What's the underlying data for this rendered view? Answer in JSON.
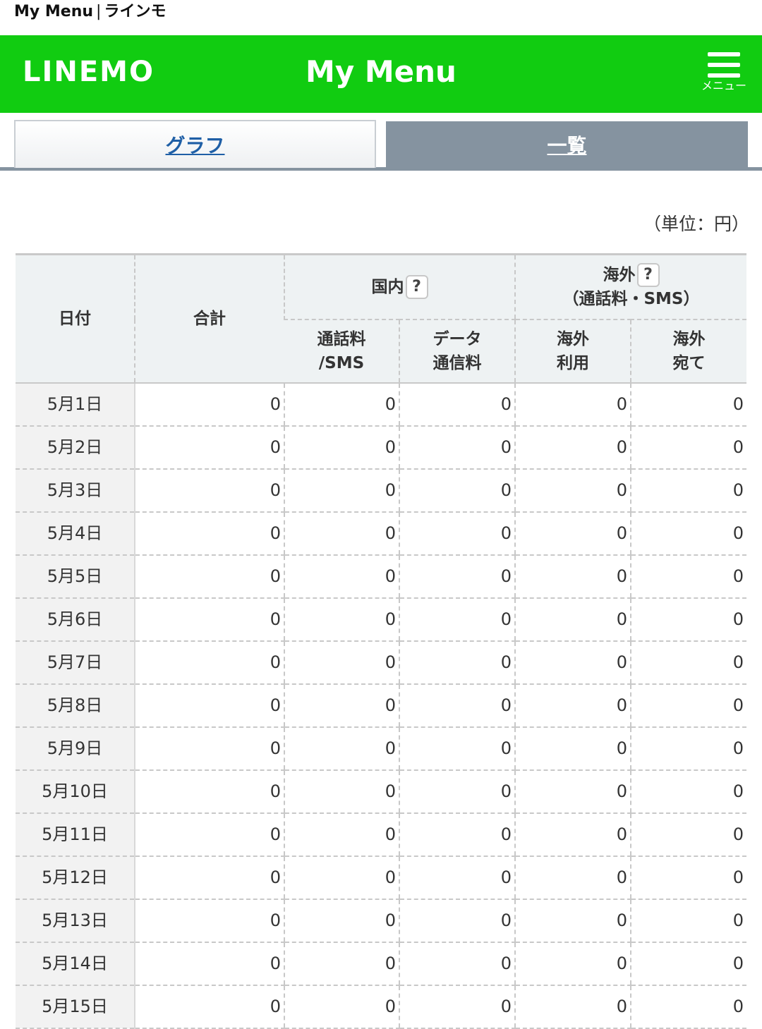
{
  "page_title": {
    "app": "My Menu",
    "sep": "|",
    "brand": "ラインモ"
  },
  "header": {
    "logo": "LINEMO",
    "title": "My Menu",
    "menu_label": "メニュー"
  },
  "tabs": [
    {
      "label": "グラフ"
    },
    {
      "label": "一覧"
    }
  ],
  "unit_label": "（単位：円）",
  "table": {
    "headers": {
      "date": "日付",
      "total": "合計",
      "domestic": "国内",
      "overseas": "海外",
      "overseas_sub": "（通話料・SMS）",
      "call_sms_1": "通話料",
      "call_sms_2": "/SMS",
      "data_1": "データ",
      "data_2": "通信料",
      "ov_use_1": "海外",
      "ov_use_2": "利用",
      "ov_to_1": "海外",
      "ov_to_2": "宛て",
      "help": "?"
    },
    "rows": [
      {
        "date": "5月1日",
        "total": "0",
        "call": "0",
        "data": "0",
        "ov_use": "0",
        "ov_to": "0"
      },
      {
        "date": "5月2日",
        "total": "0",
        "call": "0",
        "data": "0",
        "ov_use": "0",
        "ov_to": "0"
      },
      {
        "date": "5月3日",
        "total": "0",
        "call": "0",
        "data": "0",
        "ov_use": "0",
        "ov_to": "0"
      },
      {
        "date": "5月4日",
        "total": "0",
        "call": "0",
        "data": "0",
        "ov_use": "0",
        "ov_to": "0"
      },
      {
        "date": "5月5日",
        "total": "0",
        "call": "0",
        "data": "0",
        "ov_use": "0",
        "ov_to": "0"
      },
      {
        "date": "5月6日",
        "total": "0",
        "call": "0",
        "data": "0",
        "ov_use": "0",
        "ov_to": "0"
      },
      {
        "date": "5月7日",
        "total": "0",
        "call": "0",
        "data": "0",
        "ov_use": "0",
        "ov_to": "0"
      },
      {
        "date": "5月8日",
        "total": "0",
        "call": "0",
        "data": "0",
        "ov_use": "0",
        "ov_to": "0"
      },
      {
        "date": "5月9日",
        "total": "0",
        "call": "0",
        "data": "0",
        "ov_use": "0",
        "ov_to": "0"
      },
      {
        "date": "5月10日",
        "total": "0",
        "call": "0",
        "data": "0",
        "ov_use": "0",
        "ov_to": "0"
      },
      {
        "date": "5月11日",
        "total": "0",
        "call": "0",
        "data": "0",
        "ov_use": "0",
        "ov_to": "0"
      },
      {
        "date": "5月12日",
        "total": "0",
        "call": "0",
        "data": "0",
        "ov_use": "0",
        "ov_to": "0"
      },
      {
        "date": "5月13日",
        "total": "0",
        "call": "0",
        "data": "0",
        "ov_use": "0",
        "ov_to": "0"
      },
      {
        "date": "5月14日",
        "total": "0",
        "call": "0",
        "data": "0",
        "ov_use": "0",
        "ov_to": "0"
      },
      {
        "date": "5月15日",
        "total": "0",
        "call": "0",
        "data": "0",
        "ov_use": "0",
        "ov_to": "0"
      }
    ]
  }
}
